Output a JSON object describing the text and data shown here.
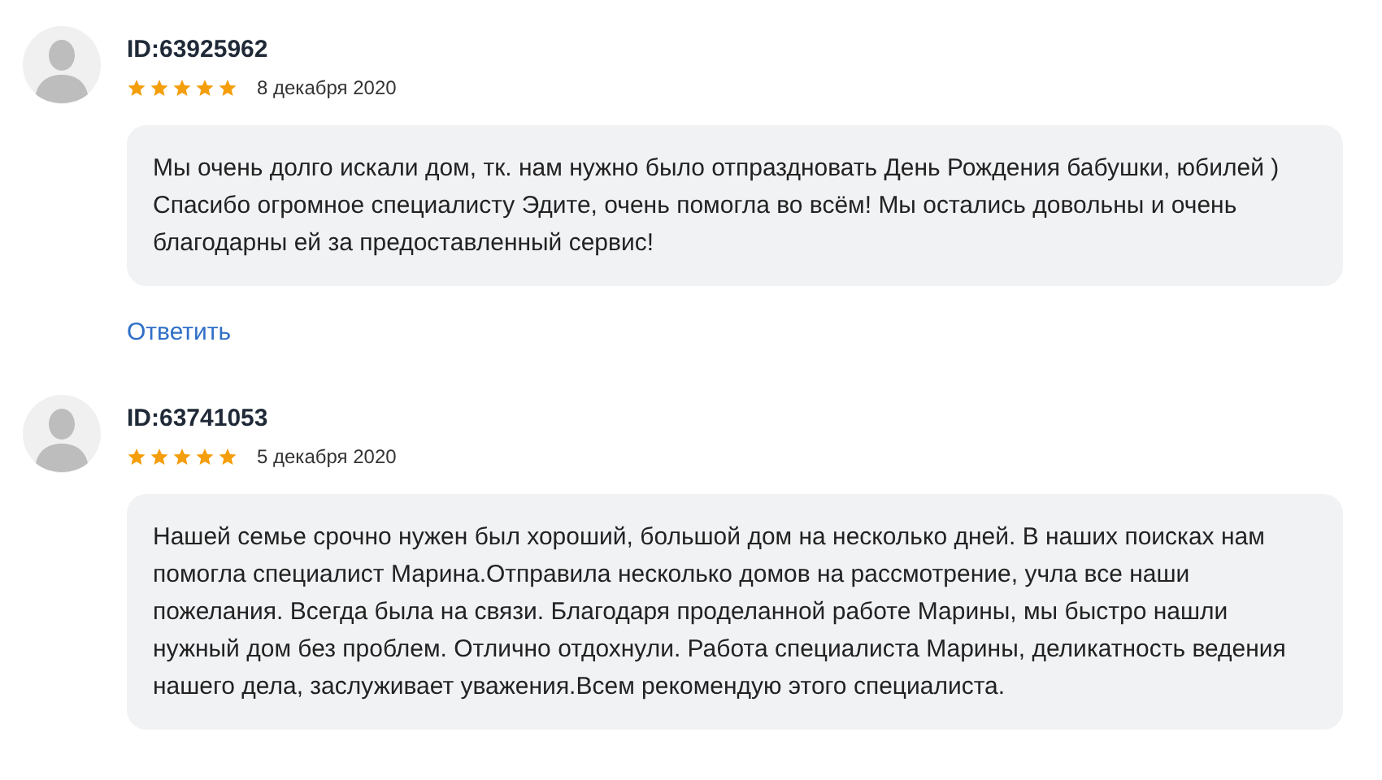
{
  "reviews": [
    {
      "author": "ID:63925962",
      "stars": 5,
      "date": "8 декабря 2020",
      "text": "Мы очень долго искали дом, тк. нам нужно было отпраздновать День Рождения бабушки, юбилей ) Спасибо огромное специалисту Эдите, очень помогла во всём! Мы остались довольны и очень благодарны ей за предоставленный сервис!",
      "reply": "Ответить"
    },
    {
      "author": "ID:63741053",
      "stars": 5,
      "date": "5 декабря 2020",
      "text": "Нашей семье срочно нужен был хороший, большой дом на несколько дней. В наших поисках нам помогла специалист Марина.Отправила несколько домов на рассмотрение, учла все наши пожелания. Всегда была на связи. Благодаря проделанной работе Марины, мы быстро нашли нужный дом без проблем. Отлично отдохнули. Работа специалиста Марины, деликатность ведения нашего дела, заслуживает уважения.Всем рекомендую этого специалиста."
    }
  ]
}
